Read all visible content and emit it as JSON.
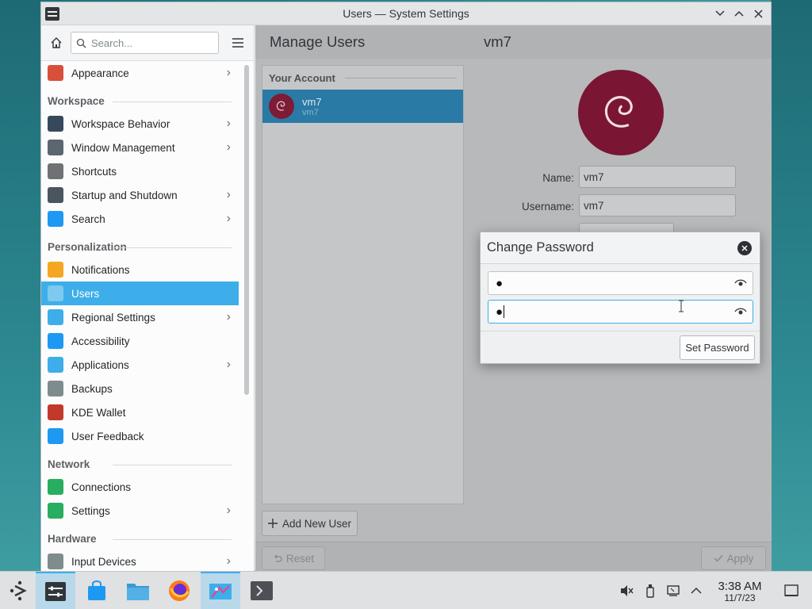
{
  "window": {
    "title": "Users — System Settings"
  },
  "sidebar": {
    "search_placeholder": "Search...",
    "items": [
      {
        "type": "item",
        "label": "Appearance",
        "icon": "appearance-icon",
        "chevron": true,
        "color": "#d84f3a"
      },
      {
        "type": "section",
        "label": "Workspace"
      },
      {
        "type": "item",
        "label": "Workspace Behavior",
        "icon": "workspace-behavior-icon",
        "chevron": true,
        "color": "#36495c"
      },
      {
        "type": "item",
        "label": "Window Management",
        "icon": "window-management-icon",
        "chevron": true,
        "color": "#5b6670"
      },
      {
        "type": "item",
        "label": "Shortcuts",
        "icon": "keyboard-icon",
        "chevron": false,
        "color": "#6e7275"
      },
      {
        "type": "item",
        "label": "Startup and Shutdown",
        "icon": "startup-icon",
        "chevron": true,
        "color": "#4a5560"
      },
      {
        "type": "item",
        "label": "Search",
        "icon": "search-icon",
        "chevron": true,
        "color": "#1d99f3"
      },
      {
        "type": "section",
        "label": "Personalization"
      },
      {
        "type": "item",
        "label": "Notifications",
        "icon": "bell-icon",
        "chevron": false,
        "color": "#f5a623"
      },
      {
        "type": "item",
        "label": "Users",
        "icon": "users-icon",
        "chevron": false,
        "color": "#3daee9",
        "selected": true
      },
      {
        "type": "item",
        "label": "Regional Settings",
        "icon": "regional-icon",
        "chevron": true,
        "color": "#3daee9"
      },
      {
        "type": "item",
        "label": "Accessibility",
        "icon": "accessibility-icon",
        "chevron": false,
        "color": "#1d99f3"
      },
      {
        "type": "item",
        "label": "Applications",
        "icon": "applications-icon",
        "chevron": true,
        "color": "#3daee9"
      },
      {
        "type": "item",
        "label": "Backups",
        "icon": "backups-icon",
        "chevron": false,
        "color": "#7f8c8d"
      },
      {
        "type": "item",
        "label": "KDE Wallet",
        "icon": "wallet-icon",
        "chevron": false,
        "color": "#c0392b"
      },
      {
        "type": "item",
        "label": "User Feedback",
        "icon": "feedback-icon",
        "chevron": false,
        "color": "#1d99f3"
      },
      {
        "type": "section",
        "label": "Network"
      },
      {
        "type": "item",
        "label": "Connections",
        "icon": "globe-icon",
        "chevron": false,
        "color": "#27ae60"
      },
      {
        "type": "item",
        "label": "Settings",
        "icon": "network-settings-icon",
        "chevron": true,
        "color": "#27ae60"
      },
      {
        "type": "section",
        "label": "Hardware"
      },
      {
        "type": "item",
        "label": "Input Devices",
        "icon": "mouse-icon",
        "chevron": true,
        "color": "#7f8c8d"
      }
    ]
  },
  "main": {
    "title": "Manage Users",
    "user_title": "vm7",
    "your_account_label": "Your Account",
    "account": {
      "name": "vm7",
      "username": "vm7"
    },
    "add_user_label": "Add New User",
    "form": {
      "name_label": "Name:",
      "name_value": "vm7",
      "username_label": "Username:",
      "username_value": "vm7"
    },
    "reset_label": "Reset",
    "apply_label": "Apply"
  },
  "dialog": {
    "title": "Change Password",
    "password_value": "●",
    "confirm_value": "●",
    "set_password_label": "Set Password"
  },
  "clock": {
    "time": "3:38 AM",
    "date": "11/7/23"
  },
  "colors": {
    "accent": "#3daee9",
    "avatar": "#7a1533"
  }
}
